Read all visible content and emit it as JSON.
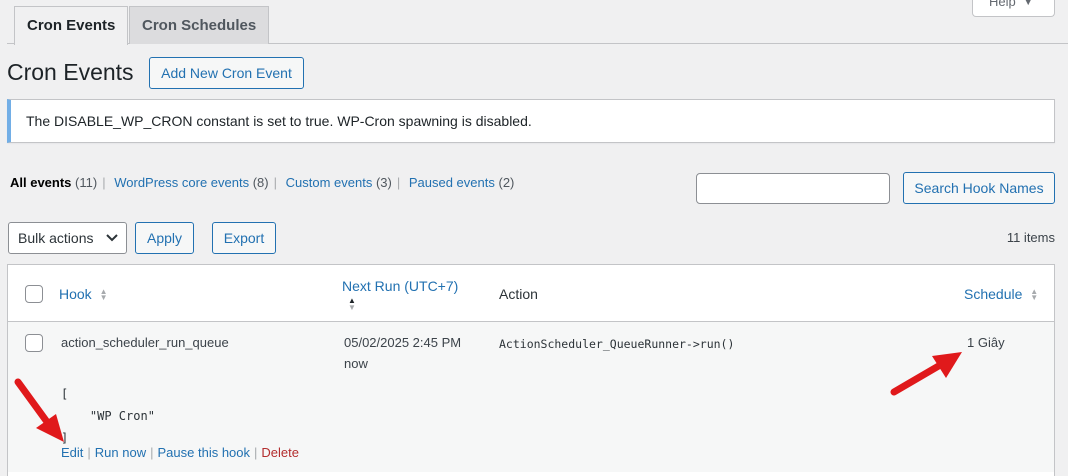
{
  "tabs": [
    {
      "label": "Cron Events",
      "active": true
    },
    {
      "label": "Cron Schedules",
      "active": false
    }
  ],
  "help": {
    "label": "Help"
  },
  "page": {
    "title": "Cron Events",
    "add_new_label": "Add New Cron Event"
  },
  "notice": {
    "text": "The DISABLE_WP_CRON constant is set to true. WP-Cron spawning is disabled."
  },
  "filters": [
    {
      "label": "All events",
      "count": "(11)",
      "current": true
    },
    {
      "label": "WordPress core events",
      "count": "(8)",
      "current": false
    },
    {
      "label": "Custom events",
      "count": "(3)",
      "current": false
    },
    {
      "label": "Paused events",
      "count": "(2)",
      "current": false
    }
  ],
  "search": {
    "value": "",
    "button_label": "Search Hook Names"
  },
  "bulk": {
    "selected": "Bulk actions",
    "apply_label": "Apply",
    "export_label": "Export"
  },
  "items_count": "11 items",
  "table": {
    "columns": {
      "hook": "Hook",
      "next_run": "Next Run (UTC+7)",
      "action": "Action",
      "schedule": "Schedule"
    },
    "rows": [
      {
        "hook": "action_scheduler_run_queue",
        "next_run_date": "05/02/2025 2:45 PM",
        "next_run_relative": "now",
        "action": "ActionScheduler_QueueRunner->run()",
        "schedule": "1 Giây",
        "args_open": "[",
        "args_value": "    \"WP Cron\"",
        "args_close": "]",
        "row_actions": {
          "edit": "Edit",
          "run_now": "Run now",
          "pause": "Pause this hook",
          "delete": "Delete"
        }
      }
    ]
  },
  "annotation_color": "#e0191b"
}
